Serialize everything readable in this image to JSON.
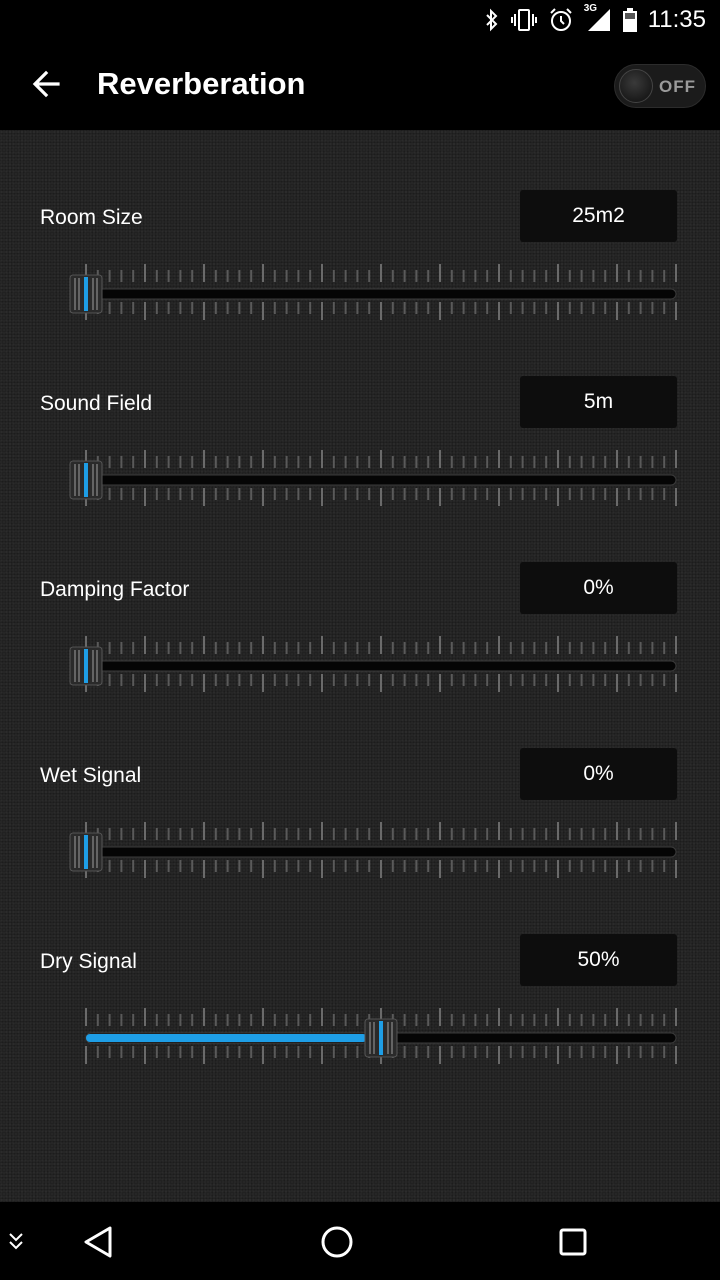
{
  "status": {
    "network": "3G",
    "time": "11:35"
  },
  "header": {
    "title": "Reverberation",
    "toggle_label": "OFF",
    "toggle_on": false
  },
  "colors": {
    "accent": "#1e9ee6",
    "background": "#262626",
    "value_box": "#0d0d0d"
  },
  "settings": [
    {
      "label": "Room Size",
      "value": "25m2",
      "position": 0.0
    },
    {
      "label": "Sound Field",
      "value": "5m",
      "position": 0.0
    },
    {
      "label": "Damping Factor",
      "value": "0%",
      "position": 0.0
    },
    {
      "label": "Wet Signal",
      "value": "0%",
      "position": 0.0
    },
    {
      "label": "Dry Signal",
      "value": "50%",
      "position": 0.5
    }
  ],
  "icons": {
    "status": [
      "bluetooth-icon",
      "vibrate-icon",
      "alarm-icon",
      "signal-icon",
      "battery-icon"
    ],
    "nav": [
      "collapse-icon",
      "back-triangle-icon",
      "home-circle-icon",
      "recents-square-icon"
    ]
  }
}
